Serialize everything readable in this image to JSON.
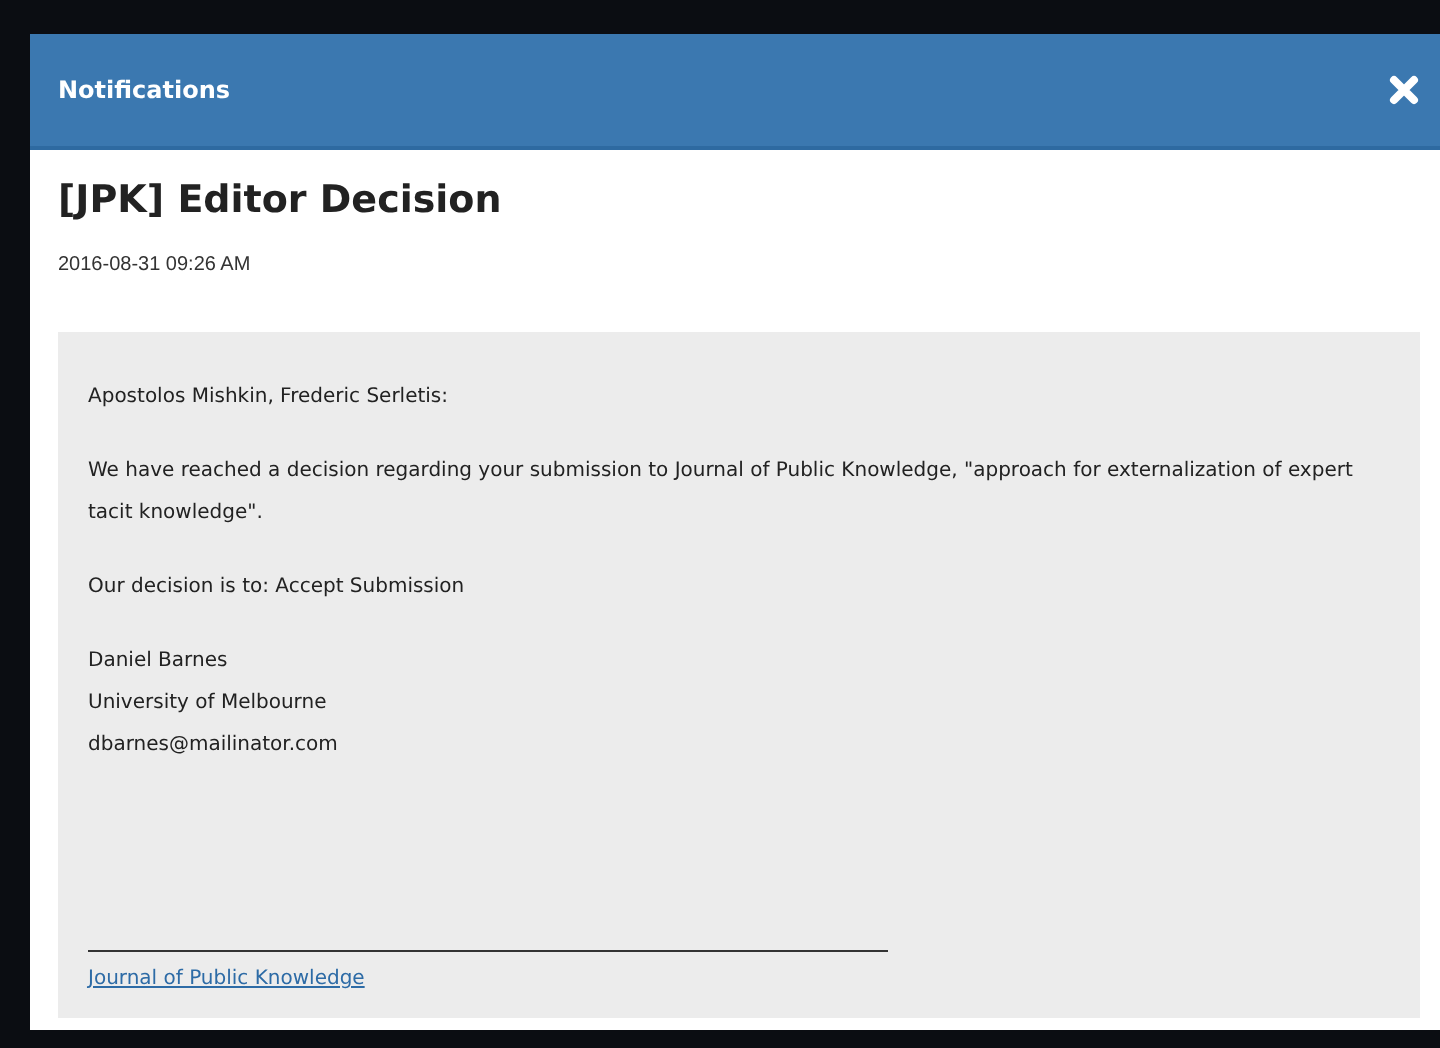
{
  "dialog": {
    "title": "Notifications"
  },
  "notification": {
    "subject": "[JPK] Editor Decision",
    "date": "2016-08-31 09:26 AM",
    "paragraphs": [
      [
        "Apostolos Mishkin, Frederic Serletis:"
      ],
      [
        "We have reached a decision regarding your submission to Journal of Public Knowledge, \"approach for externalization of expert tacit knowledge\"."
      ],
      [
        "Our decision is to: Accept Submission"
      ],
      [
        "Daniel Barnes",
        "University of Melbourne",
        "dbarnes@mailinator.com"
      ]
    ],
    "footer_link": "Journal of Public Knowledge"
  }
}
